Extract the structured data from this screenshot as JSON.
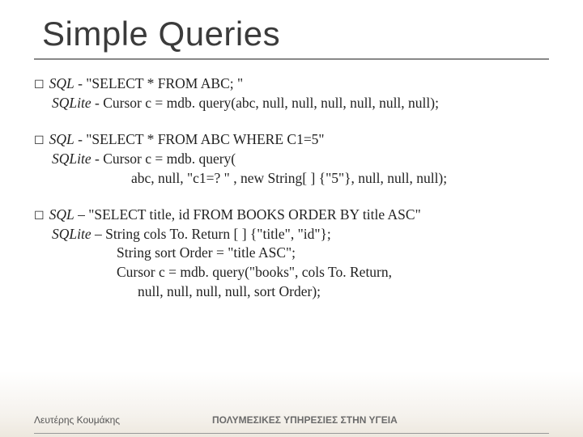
{
  "title": "Simple Queries",
  "blocks": [
    {
      "lines": [
        {
          "bullet": true,
          "italic": "SQL",
          "rest": "  -  \"SELECT * FROM ABC; \""
        },
        {
          "indent": "indent1",
          "italic": "SQLite",
          "rest": "  -  Cursor c = mdb. query(abc, null, null, null, null, null, null);"
        }
      ]
    },
    {
      "lines": [
        {
          "bullet": true,
          "italic": "SQL",
          "rest": " - \"SELECT * FROM ABC WHERE C1=5\""
        },
        {
          "indent": "indent1",
          "italic": "SQLite",
          "rest": " - Cursor c = mdb. query("
        },
        {
          "indent": "indent2",
          "rest": "abc, null, \"c1=? \" , new String[ ] {\"5\"}, null, null, null);"
        }
      ]
    },
    {
      "lines": [
        {
          "bullet": true,
          "pre": " ",
          "italic": "SQL",
          "rest": " – \"SELECT title, id FROM BOOKS ORDER BY title ASC\""
        },
        {
          "indent": "indent1",
          "italic": "SQLite",
          "rest": " – String cols To. Return [ ] {\"title\", \"id\"};"
        },
        {
          "indent": "indent2b",
          "rest": "String sort Order = \"title ASC\";"
        },
        {
          "indent": "indent2b",
          "rest": "Cursor c = mdb. query(\"books\", cols To. Return,"
        },
        {
          "indent": "indent3",
          "rest": "null, null, null, null, sort Order);"
        }
      ]
    }
  ],
  "footer": {
    "left": "Λευτέρης Κουμάκης",
    "right": "ΠΟΛΥΜΕΣΙΚΕΣ ΥΠΗΡΕΣΙΕΣ ΣΤΗΝ ΥΓΕΙΑ"
  }
}
